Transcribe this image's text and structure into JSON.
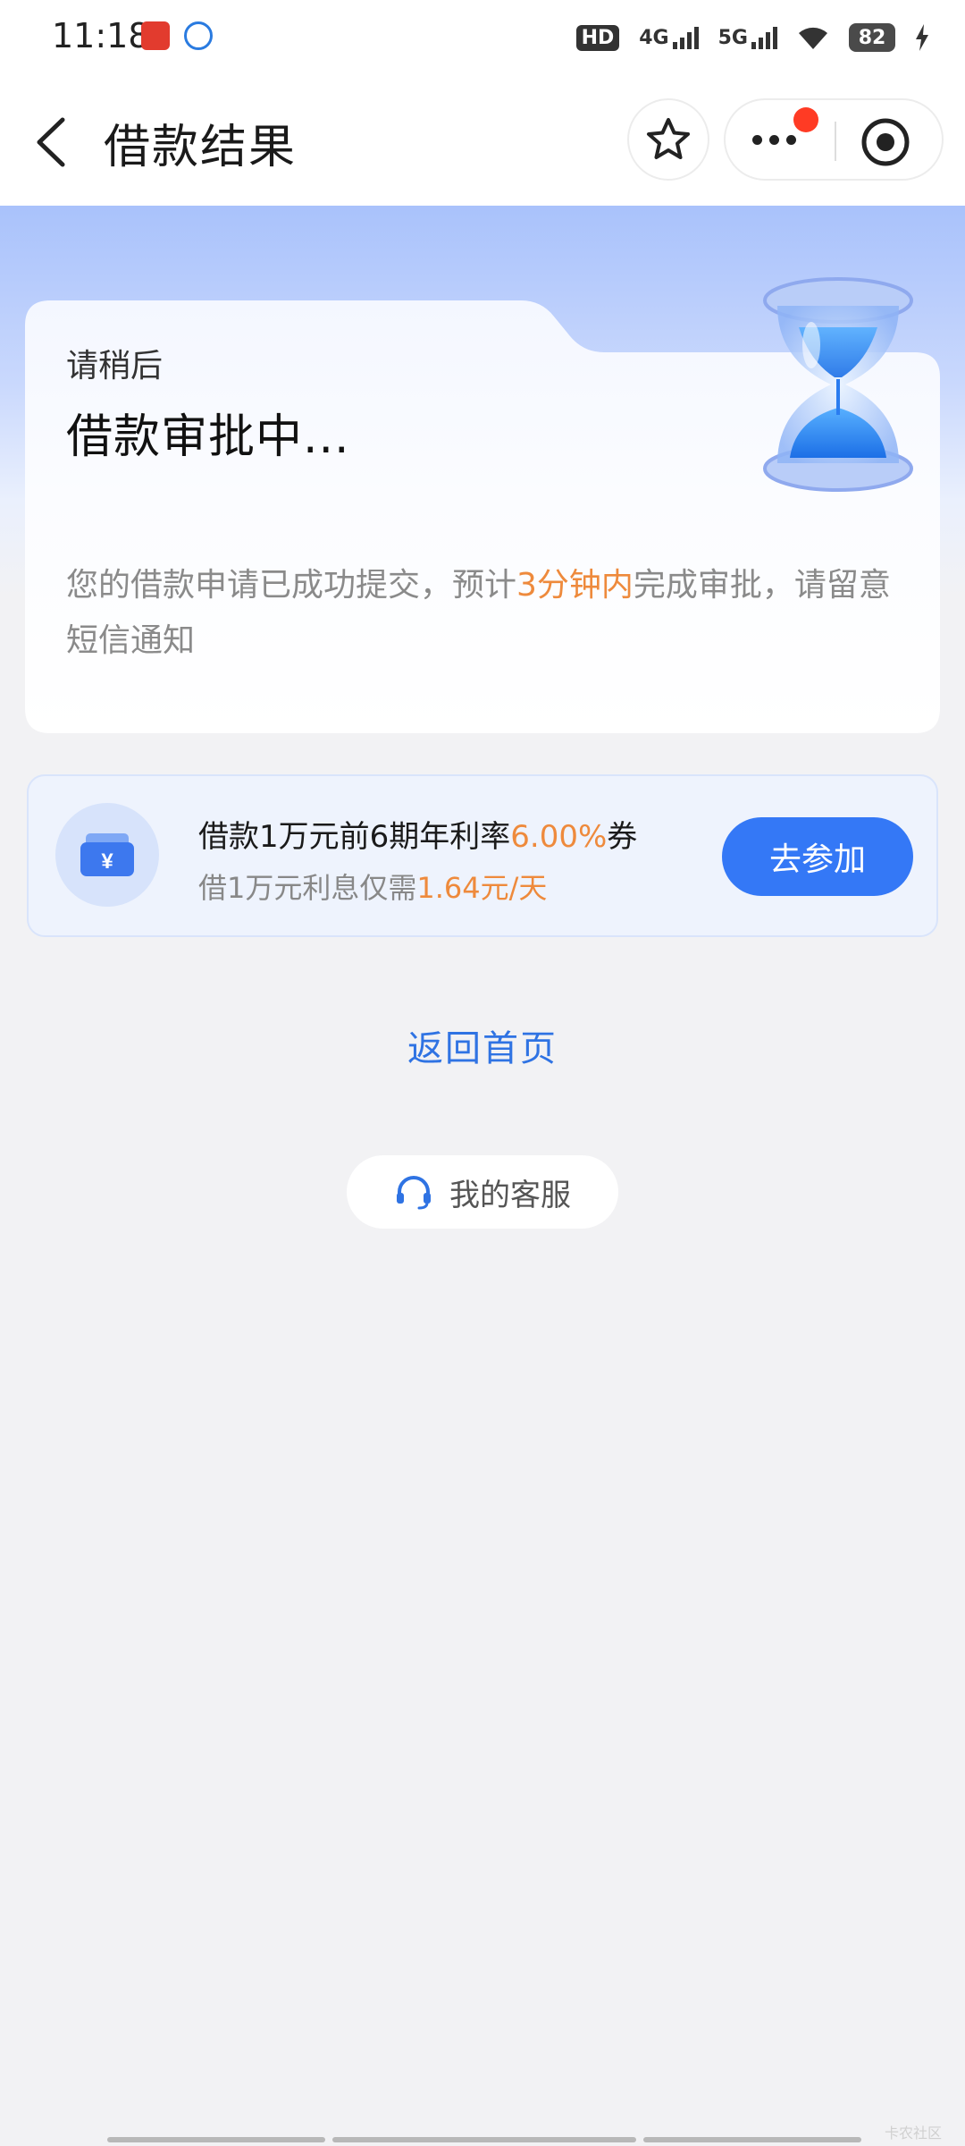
{
  "status_bar": {
    "time": "11:18",
    "hd_label": "HD",
    "net_4g": "4G",
    "net_5g": "5G",
    "battery": "82",
    "icons": [
      "app-notification-icon",
      "app-notification-icon-2",
      "hd-icon",
      "signal-4g-icon",
      "signal-5g-icon",
      "wifi-icon",
      "battery-icon",
      "charging-icon"
    ]
  },
  "header": {
    "title": "借款结果",
    "back_icon": "chevron-left-icon",
    "favorite_icon": "star-icon",
    "more_icon": "more-icon",
    "close_icon": "target-icon"
  },
  "status_card": {
    "wait_label": "请稍后",
    "title": "借款审批中...",
    "desc_prefix": "您的借款申请已成功提交，预计",
    "desc_highlight": "3分钟内",
    "desc_suffix": "完成审批，请留意短信通知",
    "illustration": "hourglass-icon"
  },
  "coupon": {
    "title_prefix": "借款1万元前6期年利率",
    "title_rate": "6.00%",
    "title_suffix": "券",
    "sub_prefix": "借1万元利息仅需",
    "sub_amount": "1.64元/天",
    "button": "去参加",
    "icon": "coupon-yuan-icon"
  },
  "links": {
    "back_home": "返回首页",
    "customer_service": "我的客服",
    "customer_service_icon": "headset-icon"
  },
  "watermark": "卡农社区",
  "colors": {
    "accent": "#3478f6",
    "link": "#2f73e3",
    "highlight": "#ee8a3c",
    "hero_top": "#a9c2fb",
    "background": "#f2f2f4"
  }
}
